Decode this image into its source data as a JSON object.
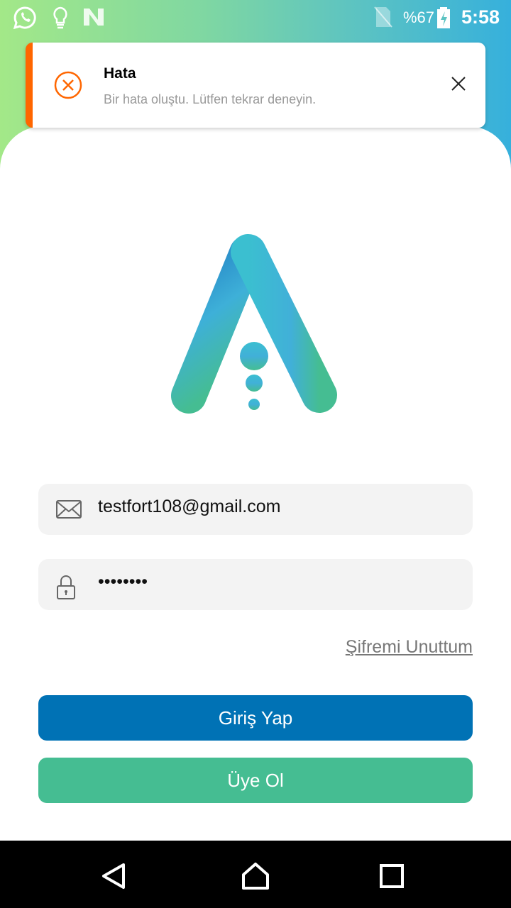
{
  "status_bar": {
    "battery": "%67",
    "time": "5:58",
    "icons": [
      "whatsapp-icon",
      "lightbulb-icon",
      "n-app-icon",
      "no-sim-icon",
      "battery-charging-icon"
    ]
  },
  "toast": {
    "title": "Hata",
    "message": "Bir hata oluştu. Lütfen tekrar deneyin.",
    "accent": "#ff6600"
  },
  "login": {
    "email": "testfort108@gmail.com",
    "password": "••••••••",
    "forgot": "Şifremi Unuttum",
    "login_button": "Giriş Yap",
    "register_button": "Üye Ol"
  },
  "colors": {
    "login_button": "#0072b5",
    "register_button": "#45bd92"
  }
}
